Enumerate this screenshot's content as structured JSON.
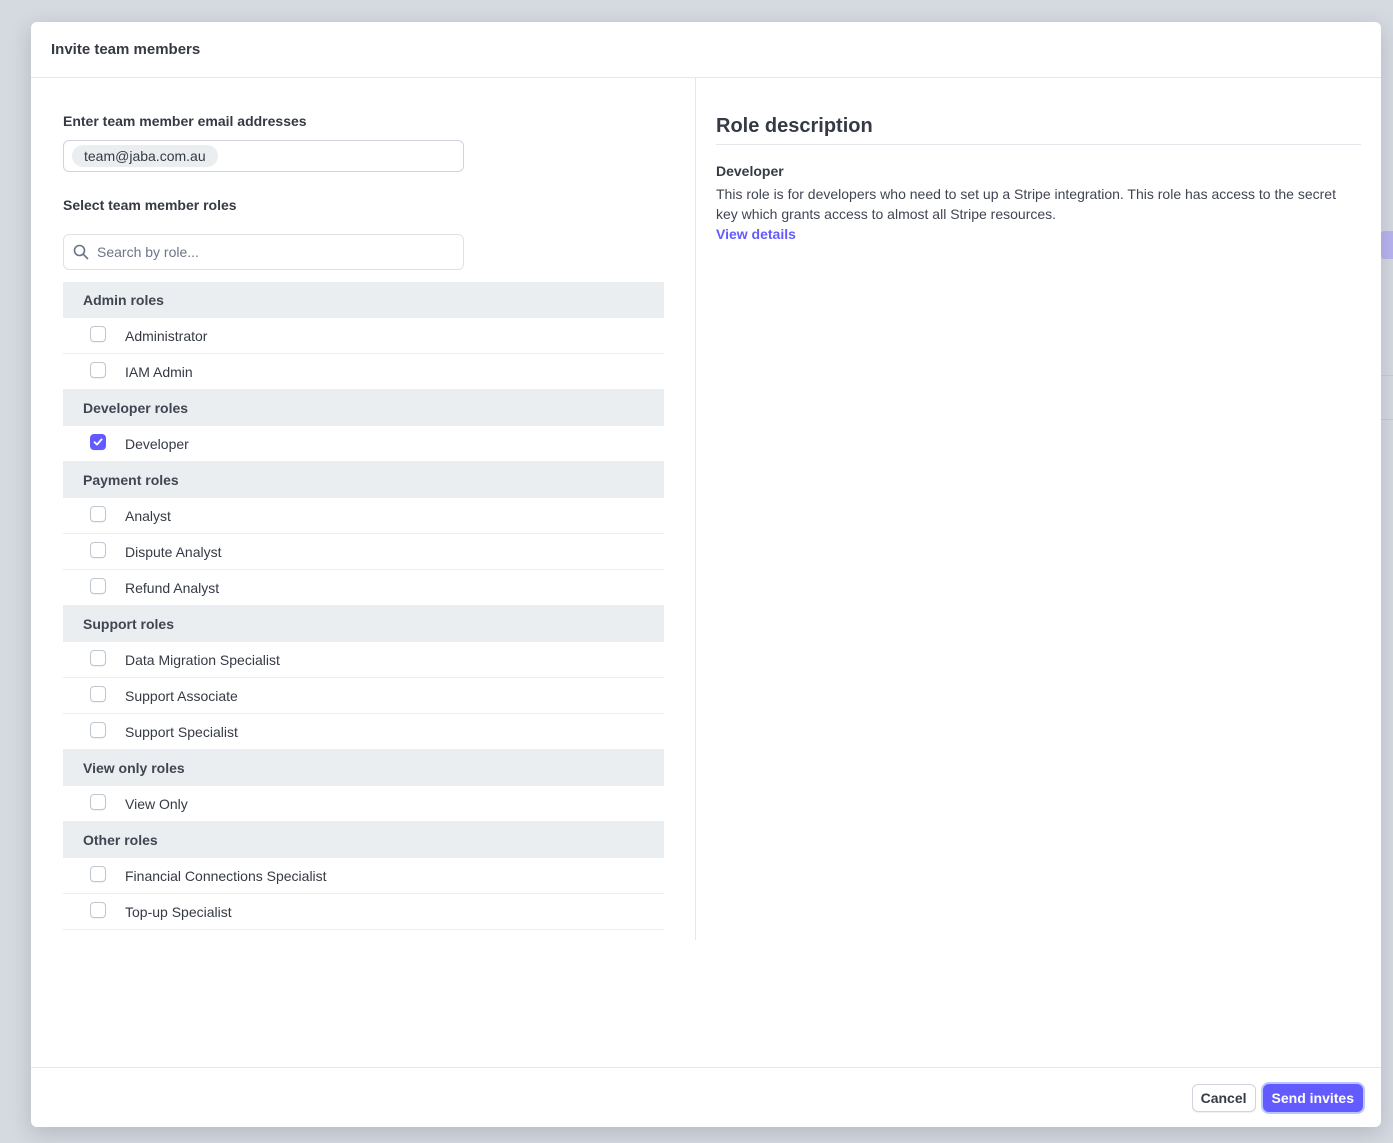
{
  "dialog": {
    "title": "Invite team members"
  },
  "emails": {
    "label": "Enter team member email addresses",
    "chips": [
      "team@jaba.com.au"
    ]
  },
  "roles": {
    "label": "Select team member roles",
    "search_placeholder": "Search by role...",
    "groups": [
      {
        "title": "Admin roles",
        "items": [
          {
            "name": "Administrator",
            "checked": false
          },
          {
            "name": "IAM Admin",
            "checked": false
          }
        ]
      },
      {
        "title": "Developer roles",
        "items": [
          {
            "name": "Developer",
            "checked": true
          }
        ]
      },
      {
        "title": "Payment roles",
        "items": [
          {
            "name": "Analyst",
            "checked": false
          },
          {
            "name": "Dispute Analyst",
            "checked": false
          },
          {
            "name": "Refund Analyst",
            "checked": false
          }
        ]
      },
      {
        "title": "Support roles",
        "items": [
          {
            "name": "Data Migration Specialist",
            "checked": false
          },
          {
            "name": "Support Associate",
            "checked": false
          },
          {
            "name": "Support Specialist",
            "checked": false
          }
        ]
      },
      {
        "title": "View only roles",
        "items": [
          {
            "name": "View Only",
            "checked": false
          }
        ]
      },
      {
        "title": "Other roles",
        "items": [
          {
            "name": "Financial Connections Specialist",
            "checked": false
          },
          {
            "name": "Top-up Specialist",
            "checked": false
          }
        ]
      }
    ]
  },
  "description": {
    "title": "Role description",
    "role": "Developer",
    "text": "This role is for developers who need to set up a Stripe integration. This role has access to the secret key which grants access to almost all Stripe resources.",
    "link": "View details"
  },
  "footer": {
    "cancel_label": "Cancel",
    "submit_label": "Send invites"
  },
  "colors": {
    "accent": "#635bff",
    "group_bg": "#ebeef1",
    "text": "#353a44"
  },
  "icons": {
    "search": "search-icon",
    "check": "check-icon"
  }
}
